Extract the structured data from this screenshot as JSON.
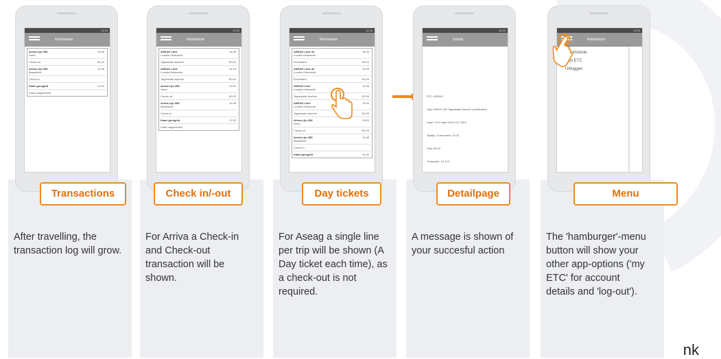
{
  "steps": [
    {
      "label": "Transactions",
      "description": "After travelling, the transaction log will grow.",
      "screen_title": "Reishistorie",
      "time": "14:35"
    },
    {
      "label": "Check in/-out",
      "description": "For Arriva a Check-in and Check-out transaction will be shown.",
      "screen_title": "Reishistorie",
      "time": "14:35"
    },
    {
      "label": "Day tickets",
      "description": "For Aseag a single line per trip will be shown (A Day ticket each time), as a check-out is not required.",
      "screen_title": "Reishistorie",
      "time": "14:35"
    },
    {
      "label": "Detailpage",
      "description": "A message is shown of your succesful action",
      "screen_title": "Details",
      "time": "15:03"
    },
    {
      "label": "Menu",
      "description": "The 'hamburger'-menu button will show your other app-options ('my ETC' for account details and 'log-out').",
      "screen_title": "Reishistorie",
      "time": "14:35",
      "menu_items": [
        "Reishistorie",
        "Mijn ETC",
        "Uitloggen"
      ]
    }
  ],
  "brand_fragment": "nk",
  "colors": {
    "accent": "#ee8a1d",
    "label_text": "#e0700c",
    "panel": "#eceef1"
  }
}
